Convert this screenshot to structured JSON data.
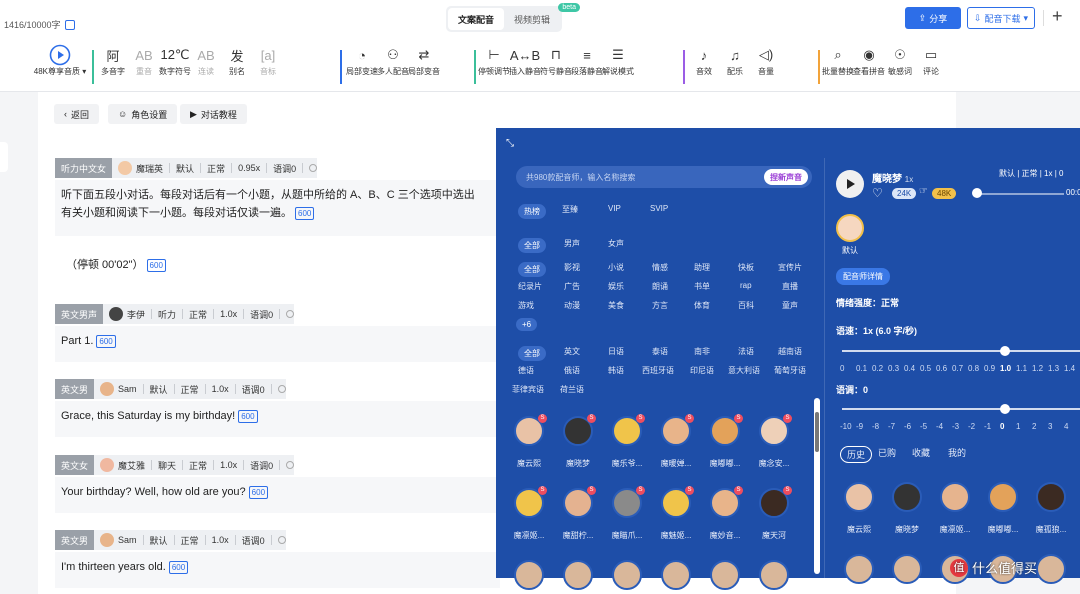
{
  "header": {
    "char_count": "1416/10000字",
    "tabs": [
      {
        "label": "文案配音",
        "active": true
      },
      {
        "label": "视频剪辑",
        "active": false,
        "badge": "beta"
      }
    ],
    "share_label": "分享",
    "download_label": "配音下载",
    "plus": "+"
  },
  "toolbar": {
    "play_label": "48K尊享音质",
    "groups": [
      [
        {
          "icon": "阿",
          "label": "多音字"
        },
        {
          "icon": "AB",
          "label": "重音",
          "dim": true
        },
        {
          "icon": "12℃",
          "label": "数字符号"
        },
        {
          "icon": "AB",
          "label": "连读",
          "dim": true
        },
        {
          "icon": "发",
          "label": "别名"
        },
        {
          "icon": "[a]",
          "label": "音标",
          "dim": true
        }
      ],
      [
        {
          "icon": "◔",
          "label": "局部变速"
        },
        {
          "icon": "⚇",
          "label": "多人配音"
        },
        {
          "icon": "⇄",
          "label": "局部变音"
        }
      ],
      [
        {
          "icon": "⊢",
          "label": "停顿调节"
        },
        {
          "icon": "A↔B",
          "label": "插入静音"
        },
        {
          "icon": "⊓",
          "label": "符号静音"
        },
        {
          "icon": "≡",
          "label": "段落静音"
        },
        {
          "icon": "☰",
          "label": "解说模式"
        }
      ],
      [
        {
          "icon": "♪",
          "label": "音效"
        },
        {
          "icon": "♫",
          "label": "配乐"
        },
        {
          "icon": "◁)",
          "label": "音量"
        }
      ],
      [
        {
          "icon": "⌕",
          "label": "批量替换"
        },
        {
          "icon": "◉",
          "label": "查看拼音"
        },
        {
          "icon": "☉",
          "label": "敏感词"
        },
        {
          "icon": "▭",
          "label": "评论"
        }
      ]
    ]
  },
  "subbar": {
    "back": "返回",
    "roles": "角色设置",
    "tutorial": "对话教程"
  },
  "segments": [
    {
      "tag": "听力中文女",
      "voice": "魔瑞英",
      "style": "默认",
      "tone": "正常",
      "speed": "0.95x",
      "pitch": "语调0",
      "text": "听下面五段小对话。每段对话后有一个小题，从题中所给的 A、B、C 三个选项中选出\n有关小题和阅读下一小题。每段对话仅读一遍。",
      "badge": "600"
    },
    {
      "tag": "",
      "voice": "",
      "text": "（停顿 00'02\"）",
      "badge": "600"
    },
    {
      "tag": "英文男声",
      "voice": "李伊",
      "style": "听力",
      "tone": "正常",
      "speed": "1.0x",
      "pitch": "语调0",
      "text": "Part 1.",
      "badge": "600"
    },
    {
      "tag": "英文男",
      "voice": "Sam",
      "style": "默认",
      "tone": "正常",
      "speed": "1.0x",
      "pitch": "语调0",
      "text": "Grace, this Saturday is my birthday!",
      "badge": "600"
    },
    {
      "tag": "英文女",
      "voice": "魔艾雅",
      "style": "聊天",
      "tone": "正常",
      "speed": "1.0x",
      "pitch": "语调0",
      "text": "Your birthday? Well, how old are you?",
      "badge": "600"
    },
    {
      "tag": "英文男",
      "voice": "Sam",
      "style": "默认",
      "tone": "正常",
      "speed": "1.0x",
      "pitch": "语调0",
      "text": "I'm thirteen years old.",
      "badge": "600"
    }
  ],
  "panel": {
    "search_placeholder": "共980款配音师，输入名称搜索",
    "new_voice": "捏新声音",
    "tier_tabs": [
      "热榜",
      "至臻",
      "VIP",
      "SVIP"
    ],
    "gender": [
      "全部",
      "男声",
      "女声"
    ],
    "scene_row1": [
      "全部",
      "影视",
      "小说",
      "情感",
      "助理",
      "快板",
      "宣传片"
    ],
    "scene_row2": [
      "纪录片",
      "广告",
      "娱乐",
      "朗诵",
      "书单",
      "rap",
      "直播"
    ],
    "scene_row3": [
      "游戏",
      "动漫",
      "美食",
      "方言",
      "体育",
      "百科",
      "童声"
    ],
    "more": "+6",
    "lang_row1": [
      "全部",
      "英文",
      "日语",
      "泰语",
      "南非",
      "法语",
      "越南语"
    ],
    "lang_row2": [
      "德语",
      "俄语",
      "韩语",
      "西班牙语",
      "印尼语",
      "意大利语",
      "葡萄牙语"
    ],
    "lang_row3": [
      "菲律宾语",
      "荷兰语"
    ],
    "grid_names_row1": [
      "魔云熙",
      "魔晓梦",
      "魔乐爷...",
      "魔暖婵...",
      "魔嘟嘟...",
      "魔念安..."
    ],
    "grid_names_row2": [
      "魔凛姬...",
      "魔甜柠...",
      "魔瞄爪...",
      "魔魅姬...",
      "魔妙音...",
      "魔天河"
    ],
    "selected": {
      "name": "魔晓梦",
      "speed_tag": "1x",
      "default_label": "默认",
      "quality": [
        "24K",
        "48K"
      ],
      "summary": "默认 | 正常 | 1x | 0",
      "time": "00:0",
      "detail_btn": "配音师详情",
      "emotion": "情绪强度：正常",
      "speed": "语速：1x (6.0 字/秒)",
      "speed_scale": [
        "0",
        "0.1",
        "0.2",
        "0.3",
        "0.4",
        "0.5",
        "0.6",
        "0.7",
        "0.8",
        "0.9",
        "1.0",
        "1.1",
        "1.2",
        "1.3",
        "1.4",
        "1.5"
      ],
      "pitch": "语调：0",
      "pitch_scale": [
        "-10",
        "-9",
        "-8",
        "-7",
        "-6",
        "-5",
        "-4",
        "-3",
        "-2",
        "-1",
        "0",
        "1",
        "2",
        "3",
        "4",
        "5",
        "6"
      ],
      "speed_value": 1.0,
      "pitch_value": 0
    },
    "history_tabs": [
      "历史",
      "已购",
      "收藏",
      "我的"
    ],
    "history_names": [
      "魔云熙",
      "魔晓梦",
      "魔凛姬...",
      "魔嘟嘟...",
      "魔孤狼..."
    ]
  },
  "watermark": "什么值得买",
  "colors": {
    "accent": "#2d6ee8",
    "panel": "#1e4ea8",
    "tag": "#9aa0a8"
  }
}
